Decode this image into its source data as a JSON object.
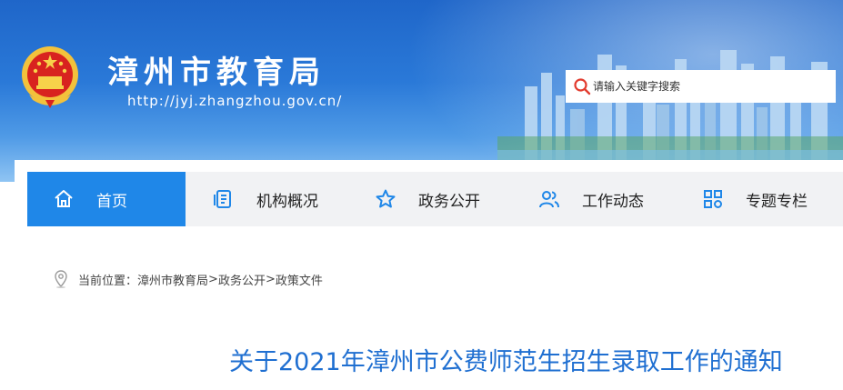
{
  "header": {
    "site_title": "漳州市教育局",
    "site_url": "http://jyj.zhangzhou.gov.cn/",
    "emblem_icon": "national-emblem-icon"
  },
  "search": {
    "placeholder": "请输入关键字搜索",
    "icon": "search-icon"
  },
  "nav": {
    "items": [
      {
        "label": "首页",
        "icon": "home-icon",
        "active": true
      },
      {
        "label": "机构概况",
        "icon": "document-list-icon",
        "active": false
      },
      {
        "label": "政务公开",
        "icon": "star-icon",
        "active": false
      },
      {
        "label": "工作动态",
        "icon": "users-icon",
        "active": false
      },
      {
        "label": "专题专栏",
        "icon": "grid-icon",
        "active": false
      }
    ]
  },
  "breadcrumb": {
    "prefix": "当前位置：",
    "items": [
      "漳州市教育局",
      "政务公开",
      "政策文件"
    ],
    "separator": ">"
  },
  "article": {
    "title": "关于2021年漳州市公费师范生招生录取工作的通知"
  },
  "colors": {
    "banner_blue": "#2a79d8",
    "nav_active": "#1f87e8",
    "nav_bg": "#f1f2f4",
    "title_blue": "#1f6fd1",
    "search_red": "#e23b2e"
  }
}
